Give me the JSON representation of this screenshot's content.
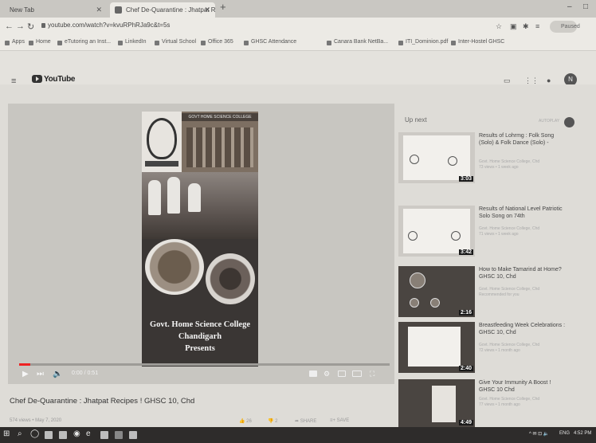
{
  "browser": {
    "tabs": [
      {
        "label": "New Tab"
      },
      {
        "label": "Chef De-Quarantine : Jhatpat Re"
      }
    ],
    "new_tab_glyph": "+",
    "window_controls": {
      "minimize": "–",
      "maximize": "□"
    },
    "url": "youtube.com/watch?v=kvuRPhRJa9c&t=5s",
    "bookmarks": [
      "Apps",
      "Home",
      "eTutoring an Inst...",
      "LinkedIn",
      "Virtual School",
      "Office 365",
      "GHSC Attendance",
      "Canara Bank NetBa...",
      "ITI_Dominion.pdf",
      "Inter-Hostel GHSC"
    ],
    "profile_label": "Paused"
  },
  "youtube": {
    "logo_text": "YouTube",
    "header_icons": [
      "video-camera-icon",
      "apps-grid-icon",
      "bell-icon"
    ],
    "avatar_letter": "N",
    "video": {
      "banner_text": "GOVT HOME SCIENCE COLLEGE",
      "caption_line1": "Govt. Home Science College",
      "caption_line2": "Chandigarh",
      "caption_line3": "Presents",
      "timecode": "0:00 / 0:51",
      "progress_fraction": 0.03
    },
    "title": "Chef De-Quarantine : Jhatpat Recipes ! GHSC 10, Chd",
    "meta": "574 views • May 7, 2020",
    "actions": [
      "26",
      "2",
      "SHARE",
      "SAVE"
    ],
    "up_next_label": "Up next",
    "autoplay_label": "AUTOPLAY",
    "recommendations": [
      {
        "title": "Results of Lohrmg : Folk Song (Solo) & Folk Dance (Solo) -",
        "channel": "Govt. Home Science College, Chd",
        "views": "73 views • 1 week ago",
        "duration": "3:03"
      },
      {
        "title": "Results of National Level Patriotic Solo Song on 74th",
        "channel": "Govt. Home Science College, Chd",
        "views": "71 views • 1 week ago",
        "duration": "3:42"
      },
      {
        "title": "How to Make Tamarind at Home? GHSC 10, Chd",
        "channel": "Govt. Home Science College, Chd",
        "views": "Recommended for you",
        "duration": "2:16"
      },
      {
        "title": "Breastfeeding Week Celebrations : GHSC 10, Chd",
        "channel": "Govt. Home Science College, Chd",
        "views": "72 views • 1 month ago",
        "duration": "2:40"
      },
      {
        "title": "Give Your Immunity A Boost ! GHSC 10 Chd",
        "channel": "Govt. Home Science College, Chd",
        "views": "77 views • 1 month ago",
        "duration": "4:49"
      }
    ]
  },
  "taskbar": {
    "clock": "4:52 PM",
    "tray_text": "ENG"
  }
}
